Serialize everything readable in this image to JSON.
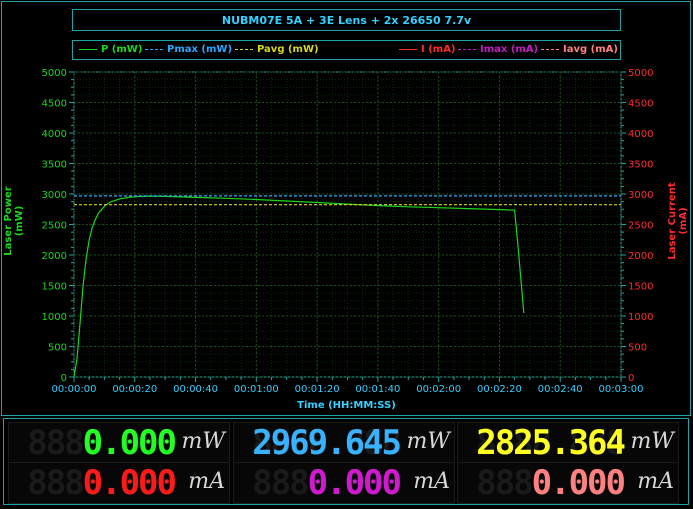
{
  "window": {
    "title": "NUBM07E 5A + 3E Lens + 2x 26650 7.7v"
  },
  "legend": [
    {
      "label": "P (mW)",
      "color": "#1bd61b",
      "style": "solid"
    },
    {
      "label": "Pmax (mW)",
      "color": "#2aa6ff",
      "style": "dashed"
    },
    {
      "label": "Pavg (mW)",
      "color": "#d6d61b",
      "style": "dashed"
    },
    {
      "label": "I (mA)",
      "color": "#ff2a2a",
      "style": "solid"
    },
    {
      "label": "Imax (mA)",
      "color": "#c21bc2",
      "style": "dashed"
    },
    {
      "label": "Iavg (mA)",
      "color": "#ff7f7f",
      "style": "dashed"
    }
  ],
  "chart_data": {
    "type": "line",
    "title": "NUBM07E 5A + 3E Lens + 2x 26650 7.7v",
    "xlabel": "Time (HH:MM:SS)",
    "ylabel": "Laser Power (mW)",
    "y2label": "Laser Current (mA)",
    "x_ticks": [
      "00:00:00",
      "00:00:20",
      "00:00:40",
      "00:01:00",
      "00:01:20",
      "00:01:40",
      "00:02:00",
      "00:02:20",
      "00:02:40",
      "00:03:00"
    ],
    "y_ticks": [
      "0",
      "500",
      "1000",
      "1500",
      "2000",
      "2500",
      "3000",
      "3500",
      "4000",
      "4500",
      "5000"
    ],
    "y2_ticks": [
      "0",
      "500",
      "1000",
      "1500",
      "2000",
      "2500",
      "3000",
      "3500",
      "4000",
      "4500",
      "5000"
    ],
    "xlim_seconds": [
      0,
      180
    ],
    "ylim": [
      0,
      5000
    ],
    "y2lim": [
      0,
      5000
    ],
    "grid": true,
    "series": [
      {
        "name": "P (mW)",
        "color": "#1bd61b",
        "x": [
          0,
          1,
          2,
          3,
          4,
          5,
          6,
          7,
          8,
          10,
          12,
          15,
          18,
          20,
          25,
          30,
          40,
          50,
          60,
          70,
          80,
          90,
          100,
          110,
          120,
          130,
          140,
          145,
          146,
          148
        ],
        "y": [
          0,
          300,
          900,
          1500,
          1950,
          2250,
          2450,
          2580,
          2680,
          2800,
          2870,
          2920,
          2945,
          2955,
          2965,
          2960,
          2945,
          2930,
          2910,
          2885,
          2860,
          2835,
          2810,
          2790,
          2775,
          2760,
          2745,
          2735,
          2200,
          1050
        ]
      },
      {
        "name": "Pmax (mW)",
        "color": "#2aa6ff",
        "style": "dashed",
        "x": [
          0,
          180
        ],
        "y": [
          2969.645,
          2969.645
        ]
      },
      {
        "name": "Pavg (mW)",
        "color": "#d6d61b",
        "style": "dashed",
        "x": [
          0,
          180
        ],
        "y": [
          2825.364,
          2825.364
        ]
      }
    ]
  },
  "readouts": [
    {
      "name": "power",
      "ghost": "8888.888",
      "value": "0.000",
      "unit": "mW",
      "color": "#22ff22"
    },
    {
      "name": "pmax",
      "ghost": "8888.888",
      "value": "2969.645",
      "unit": "mW",
      "color": "#38b2ff"
    },
    {
      "name": "pavg",
      "ghost": "8888.888",
      "value": "2825.364",
      "unit": "mW",
      "color": "#ffff22"
    },
    {
      "name": "current",
      "ghost": "8888.888",
      "value": "0.000",
      "unit": "mA",
      "color": "#ff1a1a"
    },
    {
      "name": "imax",
      "ghost": "8888.888",
      "value": "0.000",
      "unit": "mA",
      "color": "#d01ad0"
    },
    {
      "name": "iavg",
      "ghost": "8888.888",
      "value": "0.000",
      "unit": "mA",
      "color": "#ff8080"
    }
  ]
}
